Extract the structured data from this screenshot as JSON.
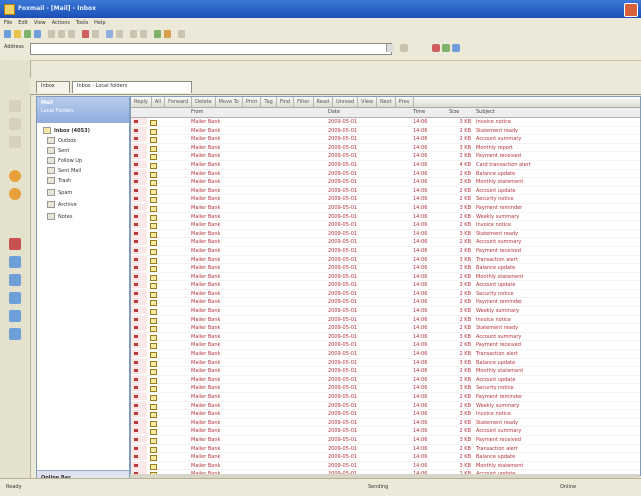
{
  "window": {
    "title": "Foxmail - [Mail] - Inbox"
  },
  "menu": [
    "File",
    "Edit",
    "View",
    "Actions",
    "Tools",
    "Help"
  ],
  "address": {
    "label": "Address",
    "value": ""
  },
  "tabs": [
    {
      "label": "Inbox"
    },
    {
      "label": "Inbox - Local folders"
    }
  ],
  "folders": {
    "header_title": "Mail",
    "header_subtitle": "Local Folders",
    "items": [
      {
        "label": "Inbox (4053)"
      },
      {
        "label": "Outbox"
      },
      {
        "label": "Sent"
      },
      {
        "label": "Follow Up"
      },
      {
        "label": "Sent Mail"
      },
      {
        "label": "Trash"
      },
      {
        "label": "Spam"
      },
      {
        "label": "Archive"
      },
      {
        "label": "Notes"
      }
    ],
    "footer_label": "Online Bar"
  },
  "quick_toolbar": [
    "Reply",
    "All",
    "Forward",
    "Delete",
    "Move To",
    "Print",
    "Tag",
    "Find",
    "Filter",
    "Read",
    "Unread",
    "View",
    "Next",
    "Prev"
  ],
  "columns": {
    "from": "From",
    "date": "Date",
    "time": "Time",
    "size": "Size",
    "subject": "Subject"
  },
  "messages": [
    {
      "from": "Mailer Bank",
      "date": "2009-05-01",
      "time": "14:06",
      "size": "3 KB",
      "subject": "Invoice notice"
    },
    {
      "from": "Mailer Bank",
      "date": "2009-05-01",
      "time": "14:06",
      "size": "2 KB",
      "subject": "Statement ready"
    },
    {
      "from": "Mailer Bank",
      "date": "2009-05-01",
      "time": "14:06",
      "size": "2 KB",
      "subject": "Account summary"
    },
    {
      "from": "Mailer Bank",
      "date": "2009-05-01",
      "time": "14:06",
      "size": "3 KB",
      "subject": "Monthly report"
    },
    {
      "from": "Mailer Bank",
      "date": "2009-05-01",
      "time": "14:06",
      "size": "2 KB",
      "subject": "Payment received"
    },
    {
      "from": "Mailer Bank",
      "date": "2009-05-01",
      "time": "14:06",
      "size": "4 KB",
      "subject": "Card transaction alert"
    },
    {
      "from": "Mailer Bank",
      "date": "2009-05-01",
      "time": "14:06",
      "size": "2 KB",
      "subject": "Balance update"
    },
    {
      "from": "Mailer Bank",
      "date": "2009-05-01",
      "time": "14:06",
      "size": "3 KB",
      "subject": "Monthly statement"
    },
    {
      "from": "Mailer Bank",
      "date": "2009-05-01",
      "time": "14:06",
      "size": "2 KB",
      "subject": "Account update"
    },
    {
      "from": "Mailer Bank",
      "date": "2009-05-01",
      "time": "14:06",
      "size": "2 KB",
      "subject": "Security notice"
    },
    {
      "from": "Mailer Bank",
      "date": "2009-05-01",
      "time": "14:06",
      "size": "3 KB",
      "subject": "Payment reminder"
    },
    {
      "from": "Mailer Bank",
      "date": "2009-05-01",
      "time": "14:06",
      "size": "2 KB",
      "subject": "Weekly summary"
    },
    {
      "from": "Mailer Bank",
      "date": "2009-05-01",
      "time": "14:06",
      "size": "2 KB",
      "subject": "Invoice notice"
    },
    {
      "from": "Mailer Bank",
      "date": "2009-05-01",
      "time": "14:06",
      "size": "3 KB",
      "subject": "Statement ready"
    },
    {
      "from": "Mailer Bank",
      "date": "2009-05-01",
      "time": "14:06",
      "size": "2 KB",
      "subject": "Account summary"
    },
    {
      "from": "Mailer Bank",
      "date": "2009-05-01",
      "time": "14:06",
      "size": "2 KB",
      "subject": "Payment received"
    },
    {
      "from": "Mailer Bank",
      "date": "2009-05-01",
      "time": "14:06",
      "size": "3 KB",
      "subject": "Transaction alert"
    },
    {
      "from": "Mailer Bank",
      "date": "2009-05-01",
      "time": "14:06",
      "size": "2 KB",
      "subject": "Balance update"
    },
    {
      "from": "Mailer Bank",
      "date": "2009-05-01",
      "time": "14:06",
      "size": "2 KB",
      "subject": "Monthly statement"
    },
    {
      "from": "Mailer Bank",
      "date": "2009-05-01",
      "time": "14:06",
      "size": "3 KB",
      "subject": "Account update"
    },
    {
      "from": "Mailer Bank",
      "date": "2009-05-01",
      "time": "14:06",
      "size": "2 KB",
      "subject": "Security notice"
    },
    {
      "from": "Mailer Bank",
      "date": "2009-05-01",
      "time": "14:06",
      "size": "2 KB",
      "subject": "Payment reminder"
    },
    {
      "from": "Mailer Bank",
      "date": "2009-05-01",
      "time": "14:06",
      "size": "3 KB",
      "subject": "Weekly summary"
    },
    {
      "from": "Mailer Bank",
      "date": "2009-05-01",
      "time": "14:06",
      "size": "2 KB",
      "subject": "Invoice notice"
    },
    {
      "from": "Mailer Bank",
      "date": "2009-05-01",
      "time": "14:06",
      "size": "2 KB",
      "subject": "Statement ready"
    },
    {
      "from": "Mailer Bank",
      "date": "2009-05-01",
      "time": "14:06",
      "size": "3 KB",
      "subject": "Account summary"
    },
    {
      "from": "Mailer Bank",
      "date": "2009-05-01",
      "time": "14:06",
      "size": "2 KB",
      "subject": "Payment received"
    },
    {
      "from": "Mailer Bank",
      "date": "2009-05-01",
      "time": "14:06",
      "size": "2 KB",
      "subject": "Transaction alert"
    },
    {
      "from": "Mailer Bank",
      "date": "2009-05-01",
      "time": "14:06",
      "size": "3 KB",
      "subject": "Balance update"
    },
    {
      "from": "Mailer Bank",
      "date": "2009-05-01",
      "time": "14:06",
      "size": "2 KB",
      "subject": "Monthly statement"
    },
    {
      "from": "Mailer Bank",
      "date": "2009-05-01",
      "time": "14:06",
      "size": "2 KB",
      "subject": "Account update"
    },
    {
      "from": "Mailer Bank",
      "date": "2009-05-01",
      "time": "14:06",
      "size": "3 KB",
      "subject": "Security notice"
    },
    {
      "from": "Mailer Bank",
      "date": "2009-05-01",
      "time": "14:06",
      "size": "2 KB",
      "subject": "Payment reminder"
    },
    {
      "from": "Mailer Bank",
      "date": "2009-05-01",
      "time": "14:06",
      "size": "2 KB",
      "subject": "Weekly summary"
    },
    {
      "from": "Mailer Bank",
      "date": "2009-05-01",
      "time": "14:06",
      "size": "3 KB",
      "subject": "Invoice notice"
    },
    {
      "from": "Mailer Bank",
      "date": "2009-05-01",
      "time": "14:06",
      "size": "2 KB",
      "subject": "Statement ready"
    },
    {
      "from": "Mailer Bank",
      "date": "2009-05-01",
      "time": "14:06",
      "size": "2 KB",
      "subject": "Account summary"
    },
    {
      "from": "Mailer Bank",
      "date": "2009-05-01",
      "time": "14:06",
      "size": "3 KB",
      "subject": "Payment received"
    },
    {
      "from": "Mailer Bank",
      "date": "2009-05-01",
      "time": "14:06",
      "size": "2 KB",
      "subject": "Transaction alert"
    },
    {
      "from": "Mailer Bank",
      "date": "2009-05-01",
      "time": "14:06",
      "size": "2 KB",
      "subject": "Balance update"
    },
    {
      "from": "Mailer Bank",
      "date": "2009-05-01",
      "time": "14:06",
      "size": "3 KB",
      "subject": "Monthly statement"
    },
    {
      "from": "Mailer Bank",
      "date": "2009-05-01",
      "time": "14:06",
      "size": "2 KB",
      "subject": "Account update"
    },
    {
      "from": "Mailer Bank",
      "date": "2009-05-01",
      "time": "14:06",
      "size": "2 KB",
      "subject": "Security notice"
    },
    {
      "from": "Mailer Bank",
      "date": "2009-05-01",
      "time": "14:06",
      "size": "3 KB",
      "subject": "Payment reminder"
    }
  ],
  "selected_index": 43,
  "status": {
    "left": "Ready",
    "center": "Sending",
    "right": "Online"
  },
  "colors": {
    "unread_text": "#b2323a",
    "title_bar": "#1c4fb8",
    "selection": "#d9d3a7"
  }
}
